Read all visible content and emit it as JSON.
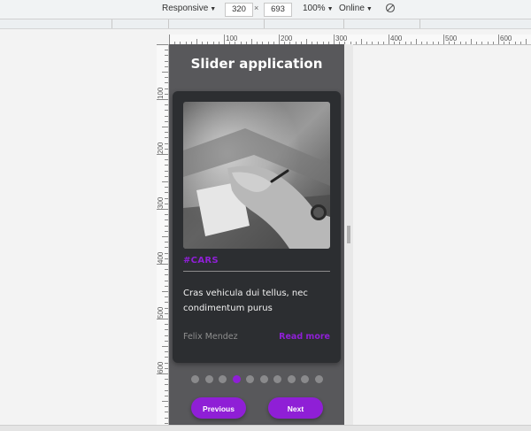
{
  "devtools": {
    "device": "Responsive",
    "width": "320",
    "times": "×",
    "height": "693",
    "zoom": "100%",
    "network": "Online",
    "caret": "▼"
  },
  "ruler": {
    "h_labels": [
      "100",
      "200",
      "300",
      "400",
      "500",
      "600"
    ],
    "v_labels": [
      "100",
      "200",
      "300",
      "400",
      "500",
      "600"
    ]
  },
  "app": {
    "title": "Slider application",
    "card": {
      "tag": "#CARS",
      "description": "Cras vehicula dui tellus, nec condimentum purus",
      "author": "Felix Mendez",
      "read_more": "Read more"
    },
    "pagination": {
      "total": 10,
      "active_index": 3
    },
    "buttons": {
      "previous": "Previous",
      "next": "Next"
    }
  },
  "colors": {
    "accent": "#8f1fd6",
    "viewport_bg": "#58585b",
    "card_bg": "#2c2e31",
    "dot_inactive": "#8a8a8c"
  }
}
